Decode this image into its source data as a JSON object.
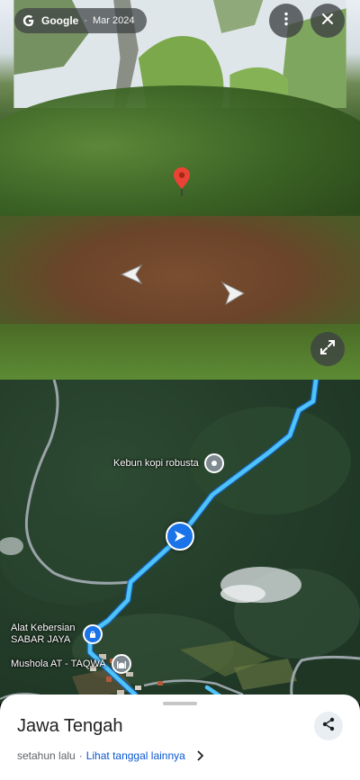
{
  "streetview": {
    "source_label": "Google",
    "separator": "·",
    "date_label": "Mar 2024",
    "icons": {
      "menu": "more-vert-icon",
      "close": "close-icon",
      "expand": "expand-icon",
      "pin": "map-pin-icon",
      "prev": "chevron-left-icon",
      "next": "chevron-right-icon"
    }
  },
  "map": {
    "pois": [
      {
        "label": "Kebun kopi robusta",
        "icon": "place-pin-icon"
      },
      {
        "label": "Alat Kebersian SABAR JAYA",
        "icon": "shopping-bag-icon"
      },
      {
        "label": "Mushola AT - TAQWA",
        "icon": "mosque-icon"
      }
    ],
    "route_color": "#4fc3f7",
    "road_color": "#9aa4a8"
  },
  "sheet": {
    "title": "Jawa Tengah",
    "when": "setahun lalu",
    "separator": "·",
    "link": "Lihat tanggal lainnya",
    "share_icon": "share-icon"
  }
}
